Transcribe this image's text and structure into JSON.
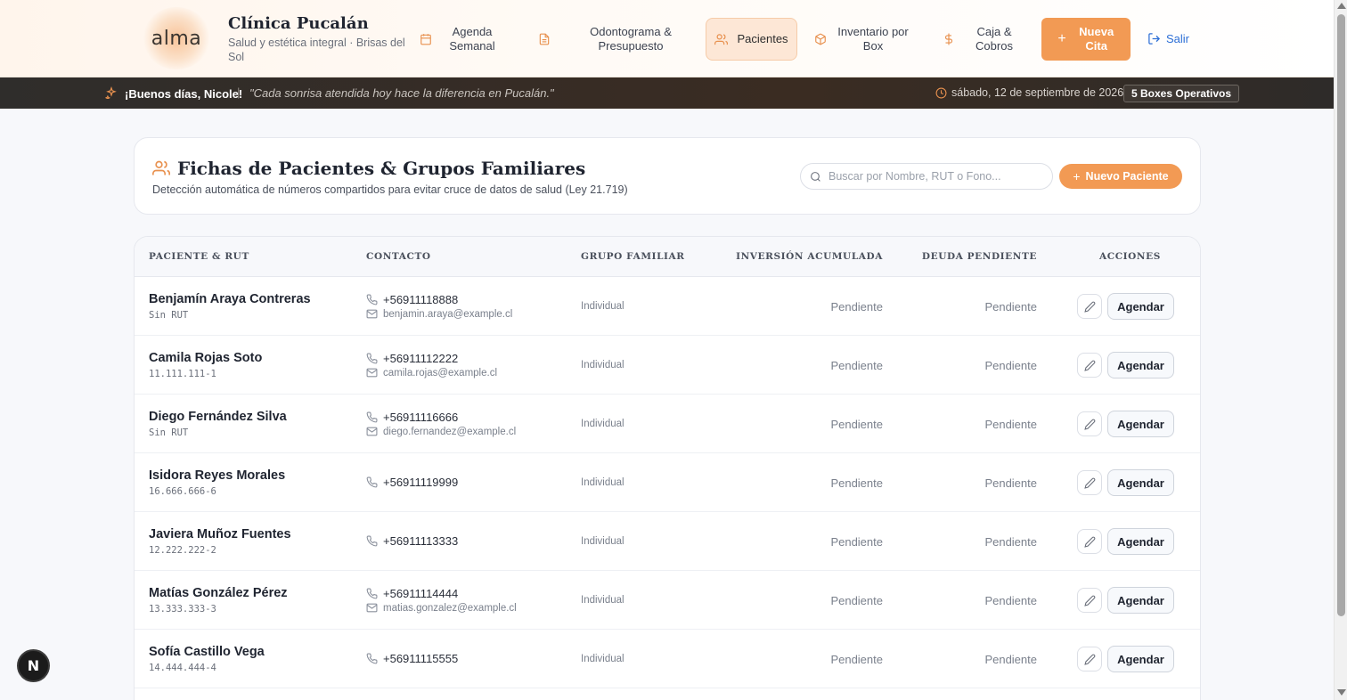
{
  "header": {
    "logo_text": "alma",
    "clinic_name": "Clínica Pucalán",
    "clinic_subtitle": "Salud y estética integral · Brisas del Sol",
    "nav": [
      {
        "label": "Agenda Semanal",
        "icon": "calendar-icon"
      },
      {
        "label": "Odontograma & Presupuesto",
        "icon": "document-icon"
      },
      {
        "label": "Pacientes",
        "icon": "users-icon",
        "active": true
      },
      {
        "label": "Inventario por Box",
        "icon": "box-icon"
      },
      {
        "label": "Caja & Cobros",
        "icon": "dollar-icon"
      }
    ],
    "new_appointment_label": "Nueva Cita",
    "logout_label": "Salir"
  },
  "strip": {
    "greeting": "¡Buenos días, Nicole!",
    "separator": "|",
    "quote": "\"Cada sonrisa atendida hoy hace la diferencia en Pucalán.\"",
    "date": "sábado, 12 de septiembre de 2026",
    "boxes_badge": "5 Boxes Operativos"
  },
  "patients_section": {
    "title": "Fichas de Pacientes & Grupos Familiares",
    "subtitle": "Detección automática de números compartidos para evitar cruce de datos de salud (Ley 21.719)",
    "search_placeholder": "Buscar por Nombre, RUT o Fono...",
    "new_patient_label": "Nuevo Paciente"
  },
  "table": {
    "columns": {
      "patient": "PACIENTE & RUT",
      "contact": "CONTACTO",
      "family": "GRUPO FAMILIAR",
      "investment": "INVERSIÓN ACUMULADA",
      "debt": "DEUDA PENDIENTE",
      "actions": "ACCIONES"
    },
    "action_label": "Agendar",
    "rows": [
      {
        "name": "Benjamín Araya Contreras",
        "rut": "Sin RUT",
        "phone": "+56911118888",
        "email": "benjamin.araya@example.cl",
        "group": "Individual",
        "investment": "Pendiente",
        "debt": "Pendiente"
      },
      {
        "name": "Camila Rojas Soto",
        "rut": "11.111.111-1",
        "phone": "+56911112222",
        "email": "camila.rojas@example.cl",
        "group": "Individual",
        "investment": "Pendiente",
        "debt": "Pendiente"
      },
      {
        "name": "Diego Fernández Silva",
        "rut": "Sin RUT",
        "phone": "+56911116666",
        "email": "diego.fernandez@example.cl",
        "group": "Individual",
        "investment": "Pendiente",
        "debt": "Pendiente"
      },
      {
        "name": "Isidora Reyes Morales",
        "rut": "16.666.666-6",
        "phone": "+56911119999",
        "email": "",
        "group": "Individual",
        "investment": "Pendiente",
        "debt": "Pendiente"
      },
      {
        "name": "Javiera Muñoz Fuentes",
        "rut": "12.222.222-2",
        "phone": "+56911113333",
        "email": "",
        "group": "Individual",
        "investment": "Pendiente",
        "debt": "Pendiente"
      },
      {
        "name": "Matías González Pérez",
        "rut": "13.333.333-3",
        "phone": "+56911114444",
        "email": "matias.gonzalez@example.cl",
        "group": "Individual",
        "investment": "Pendiente",
        "debt": "Pendiente"
      },
      {
        "name": "Sofía Castillo Vega",
        "rut": "14.444.444-4",
        "phone": "+56911115555",
        "email": "",
        "group": "Individual",
        "investment": "Pendiente",
        "debt": "Pendiente"
      }
    ]
  },
  "dev_badge": "N",
  "colors": {
    "accent": "#f29a54",
    "active_nav_bg": "#fde7d6",
    "strip_bg": "#2f2d2b"
  }
}
